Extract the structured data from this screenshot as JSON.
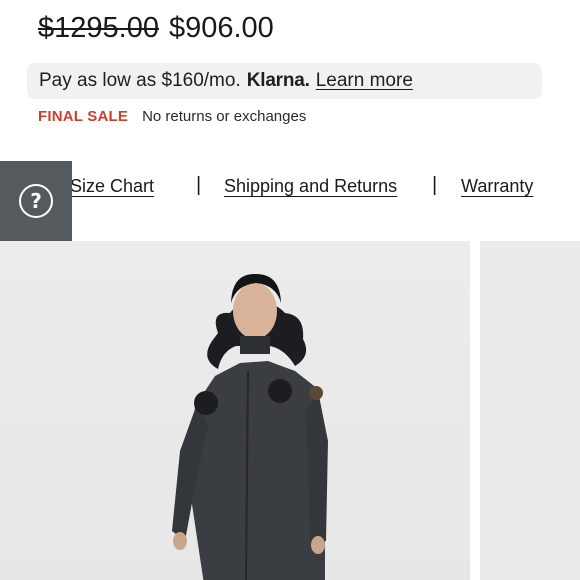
{
  "price": {
    "original": "$1295.00",
    "sale": "$906.00"
  },
  "klarna": {
    "text": "Pay as low as $160/mo.",
    "logo": "Klarna.",
    "link": "Learn more"
  },
  "sale_notice": {
    "badge": "FINAL SALE",
    "text": "No returns or exchanges",
    "badge_color": "#c8412f"
  },
  "links": {
    "size_chart": "w Size Chart",
    "shipping": "Shipping and Returns",
    "warranty": "Warranty",
    "separator": "|"
  },
  "help": {
    "icon": "question-mark-icon",
    "glyph": "?"
  },
  "gallery": {
    "image_description_icon": "product-photo"
  }
}
